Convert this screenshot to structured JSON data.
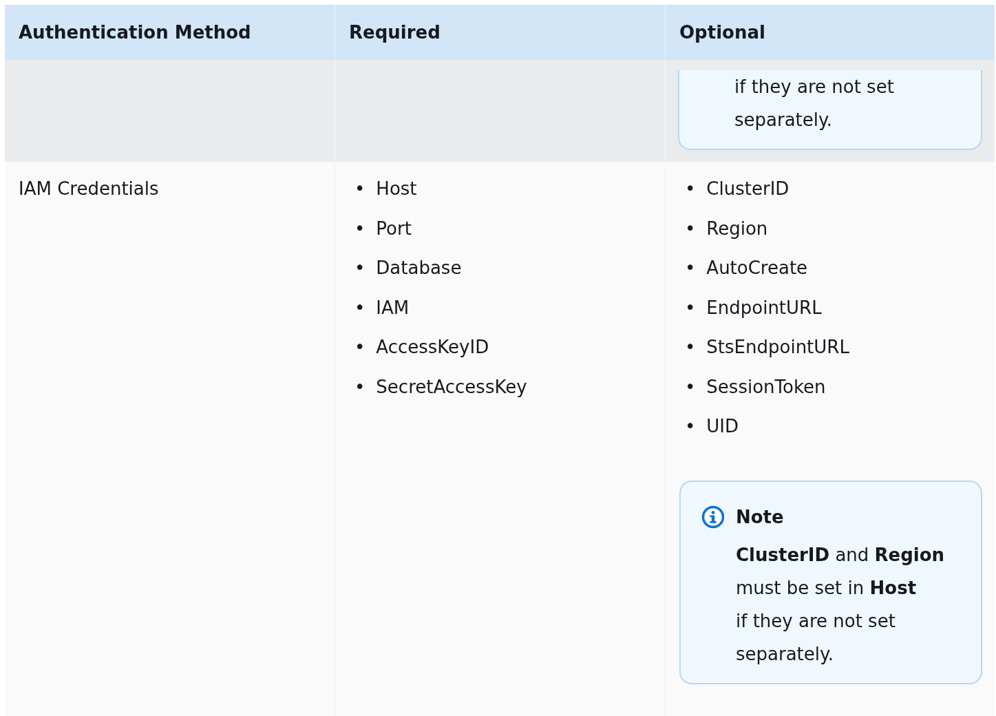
{
  "table": {
    "list_marker": "•",
    "columns": [
      "Authentication Method",
      "Required",
      "Optional"
    ],
    "partial_row": {
      "note_lines": [
        "if they are not set",
        "separately."
      ]
    },
    "rows": [
      {
        "method": "IAM Credentials",
        "required": [
          "Host",
          "Port",
          "Database",
          "IAM",
          "AccessKeyID",
          "SecretAccessKey"
        ],
        "optional": [
          "ClusterID",
          "Region",
          "AutoCreate",
          "EndpointURL",
          "StsEndpointURL",
          "SessionToken",
          "UID"
        ],
        "note": {
          "title": "Note",
          "lines": [
            "**ClusterID** and **Region**",
            "must be set in **Host**",
            "if they are not set",
            "separately."
          ]
        }
      }
    ]
  }
}
